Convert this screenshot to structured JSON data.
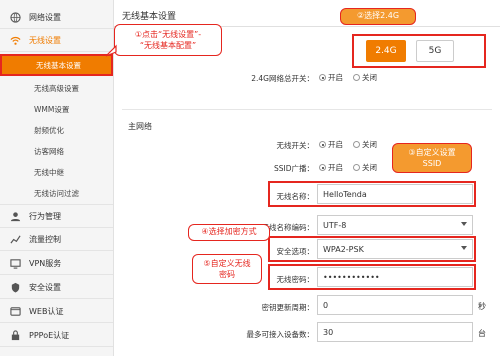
{
  "sidebar": {
    "top_items": [
      {
        "label": "网络设置",
        "icon": "globe-icon"
      },
      {
        "label": "无线设置",
        "icon": "wifi-icon"
      },
      {
        "label": "行为管理",
        "icon": "user-icon"
      },
      {
        "label": "流量控制",
        "icon": "traffic-icon"
      },
      {
        "label": "VPN服务",
        "icon": "vpn-icon"
      },
      {
        "label": "安全设置",
        "icon": "shield-icon"
      },
      {
        "label": "WEB认证",
        "icon": "web-auth-icon"
      },
      {
        "label": "PPPoE认证",
        "icon": "pppoe-icon"
      }
    ],
    "sub_items": [
      {
        "label": "无线基本设置"
      },
      {
        "label": "无线高级设置"
      },
      {
        "label": "WMM设置"
      },
      {
        "label": "射频优化"
      },
      {
        "label": "访客网络"
      },
      {
        "label": "无线中继"
      },
      {
        "label": "无线访问过滤"
      }
    ]
  },
  "header": {
    "title": "无线基本设置"
  },
  "bands": {
    "selected": "2.4G",
    "other": "5G"
  },
  "master_switch": {
    "label": "2.4G网络总开关：",
    "on": "开启",
    "off": "关闭",
    "value": "on"
  },
  "section_title": "主网络",
  "form": {
    "wifi_switch": {
      "label": "无线开关：",
      "on": "开启",
      "off": "关闭",
      "value": "on"
    },
    "ssid_broadcast": {
      "label": "SSID广播：",
      "on": "开启",
      "off": "关闭",
      "value": "on"
    },
    "ssid": {
      "label": "无线名称：",
      "value": "HelloTenda"
    },
    "encoding": {
      "label": "无线名称编码：",
      "value": "UTF-8"
    },
    "security": {
      "label": "安全选项：",
      "value": "WPA2-PSK"
    },
    "password": {
      "label": "无线密码：",
      "value": "••••••••••••"
    },
    "key_update": {
      "label": "密钥更新周期：",
      "value": "0",
      "unit": "秒"
    },
    "max_devices": {
      "label": "最多可接入设备数：",
      "value": "30",
      "unit": "台"
    }
  },
  "callouts": {
    "c1": "①点击“无线设置”-\n“无线基本配置”",
    "c2": "②选择2.4G",
    "c3": "③自定义设置\nSSID",
    "c4": "④选择加密方式",
    "c5": "⑤自定义无线\n密码"
  },
  "colors": {
    "accent": "#f07c00",
    "highlight": "#e5261f"
  }
}
